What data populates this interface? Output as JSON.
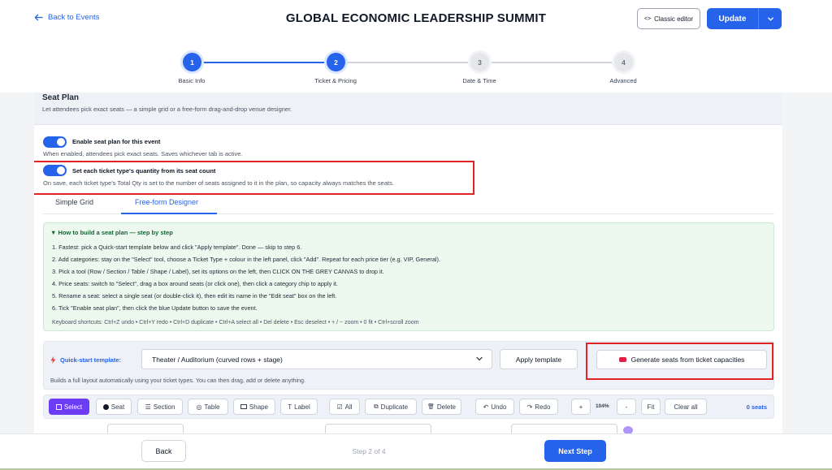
{
  "header": {
    "back_label": "Back to Events",
    "title": "GLOBAL ECONOMIC LEADERSHIP SUMMIT",
    "classic_label": "Classic editor",
    "classic_icon": "code-icon",
    "update_label": "Update"
  },
  "stepper": {
    "steps": [
      {
        "number": "1",
        "label": "Basic Info",
        "state": "active"
      },
      {
        "number": "2",
        "label": "Ticket & Pricing",
        "state": "active"
      },
      {
        "number": "3",
        "label": "Date & Time",
        "state": "inactive"
      },
      {
        "number": "4",
        "label": "Advanced",
        "state": "inactive"
      }
    ]
  },
  "seat_plan": {
    "title": "Seat Plan",
    "description": "Let attendees pick exact seats — a simple grid or a free-form drag-and-drop venue designer.",
    "enable": {
      "label": "Enable seat plan for this event",
      "description": "When enabled, attendees pick exact seats. Saves whichever tab is active.",
      "on": true
    },
    "qty_from_seats": {
      "label": "Set each ticket type's quantity from its seat count",
      "description": "On save, each ticket type's Total Qty is set to the number of seats assigned to it in the plan, so capacity always matches the seats.",
      "on": true
    },
    "tabs": [
      {
        "label": "Simple Grid",
        "active": false
      },
      {
        "label": "Free-form Designer",
        "active": true
      }
    ]
  },
  "howto": {
    "title": "▼ How to build a seat plan — step by step",
    "steps": [
      "1. Fastest: pick a Quick-start template below and click \"Apply template\". Done — skip to step 6.",
      "2. Add categories: stay on the \"Select\" tool, choose a Ticket Type + colour in the left panel, click \"Add\". Repeat for each price tier (e.g. VIP, General).",
      "3. Pick a tool (Row / Section / Table / Shape / Label), set its options on the left, then CLICK ON THE GREY CANVAS to drop it.",
      "4. Price seats: switch to \"Select\", drag a box around seats (or click one), then click a category chip to apply it.",
      "5. Rename a seat: select a single seat (or double-click it), then edit its name in the \"Edit seat\" box on the left.",
      "6. Tick \"Enable seat plan\", then click the blue Update button to save the event."
    ],
    "shortcuts": "Keyboard shortcuts: Ctrl+Z undo • Ctrl+Y redo • Ctrl+D duplicate • Ctrl+A select all • Del delete • Esc deselect • + / − zoom • 0 fit • Ctrl+scroll zoom"
  },
  "quickstart": {
    "label": "Quick-start template:",
    "selected": "Theater / Auditorium (curved rows + stage)",
    "apply_label": "Apply template",
    "generate_label": "Generate seats from ticket capacities",
    "note": "Builds a full layout automatically using your ticket types. You can then drag, add or delete anything."
  },
  "toolbar": {
    "select": "Select",
    "seat": "Seat",
    "section": "Section",
    "table": "Table",
    "shape": "Shape",
    "label": "Label",
    "all": "All",
    "duplicate": "Duplicate",
    "delete": "Delete",
    "undo": "Undo",
    "redo": "Redo",
    "zoom_in": "+",
    "zoom": "104%",
    "zoom_out": "-",
    "fit": "Fit",
    "clear": "Clear all",
    "seat_count": "0 seats"
  },
  "footer": {
    "back_label": "Back",
    "step_indicator": "Step 2 of 4",
    "next_label": "Next Step"
  },
  "colors": {
    "primary": "#2563eb",
    "tool_active": "#6d3df5",
    "highlight": "#e02424",
    "howto_bg": "#edf8ef",
    "generate_dot": "#e11d48"
  }
}
